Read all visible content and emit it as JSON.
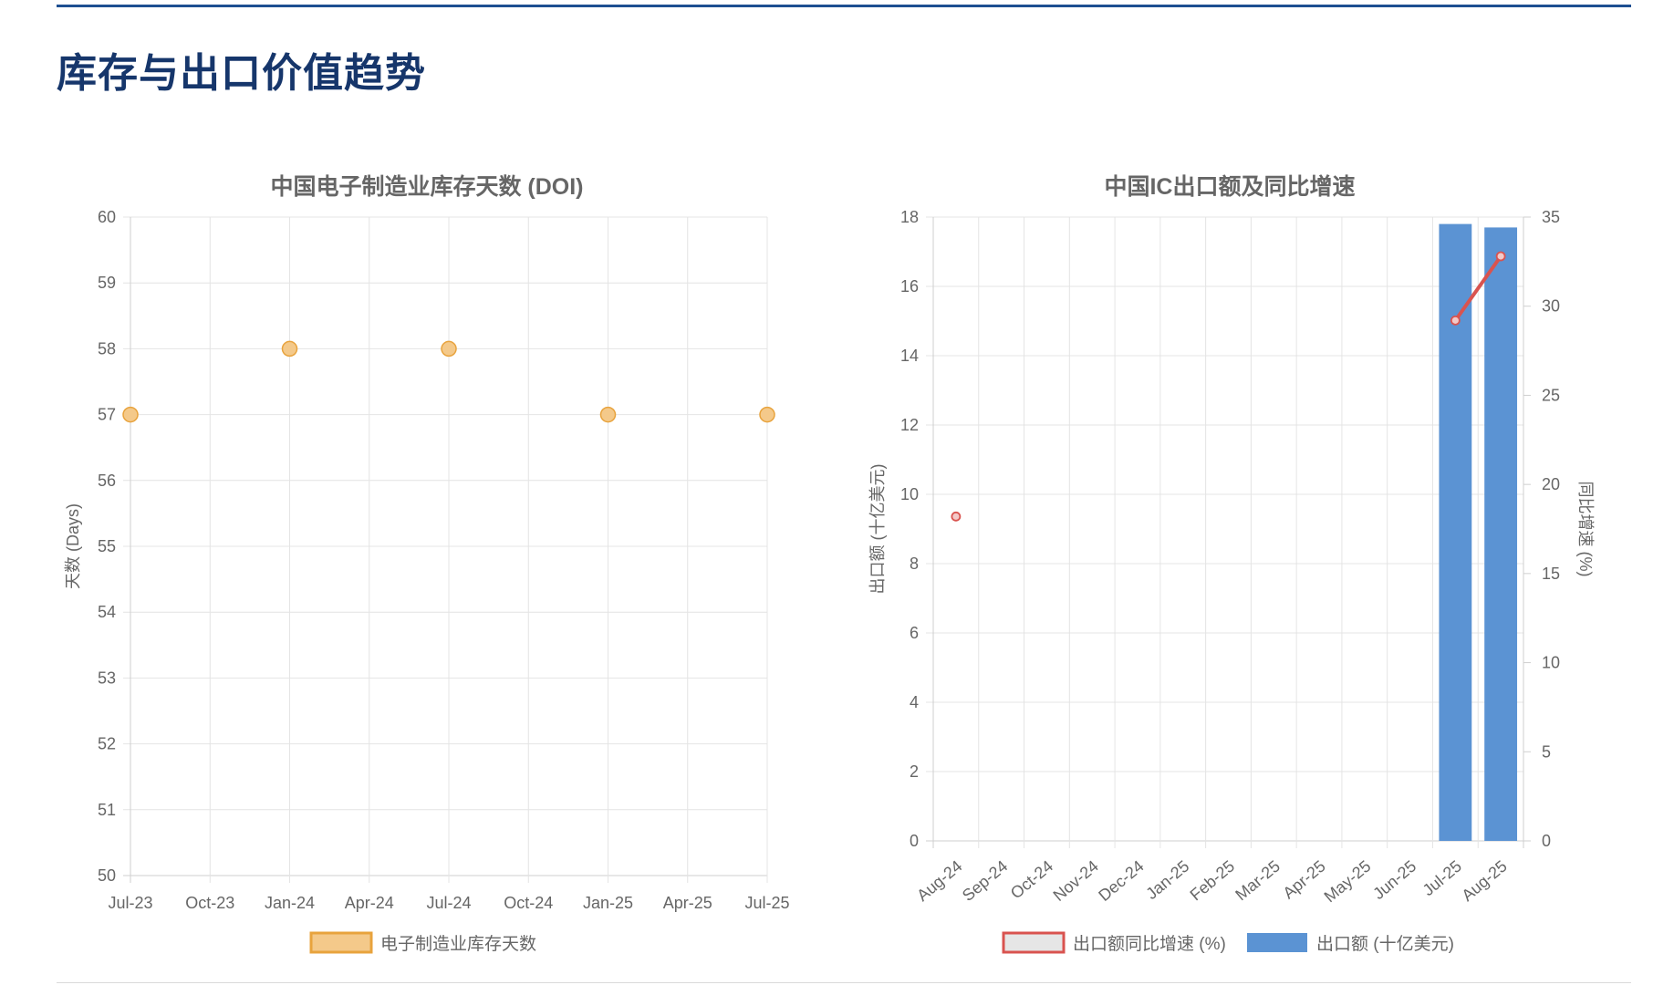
{
  "page": {
    "title": "库存与出口价值趋势"
  },
  "chart_data": [
    {
      "id": "doi",
      "type": "scatter",
      "title": "中国电子制造业库存天数 (DOI)",
      "xlabel": "",
      "ylabel": "天数 (Days)",
      "x_ticks": [
        "Jul-23",
        "Oct-23",
        "Jan-24",
        "Apr-24",
        "Jul-24",
        "Oct-24",
        "Jan-25",
        "Apr-25",
        "Jul-25"
      ],
      "ylim": [
        50,
        60
      ],
      "y_ticks": [
        50,
        51,
        52,
        53,
        54,
        55,
        56,
        57,
        58,
        59,
        60
      ],
      "grid": true,
      "legend_position": "bottom",
      "series": [
        {
          "name": "电子制造业库存天数",
          "color": "#f4c98a",
          "border_color": "#e8a33d",
          "points": [
            {
              "x": "Jul-23",
              "y": 57
            },
            {
              "x": "Jan-24",
              "y": 58
            },
            {
              "x": "Jul-24",
              "y": 58
            },
            {
              "x": "Jan-25",
              "y": 57
            },
            {
              "x": "Jul-25",
              "y": 57
            }
          ]
        }
      ]
    },
    {
      "id": "ic",
      "type": "bar",
      "title": "中国IC出口额及同比增速",
      "categories": [
        "Aug-24",
        "Sep-24",
        "Oct-24",
        "Nov-24",
        "Dec-24",
        "Jan-25",
        "Feb-25",
        "Mar-25",
        "Apr-25",
        "May-25",
        "Jun-25",
        "Jul-25",
        "Aug-25"
      ],
      "ylabel": "出口额 (十亿美元)",
      "y2label": "同比增速 (%)",
      "ylim": [
        0,
        18
      ],
      "y_ticks": [
        0,
        2,
        4,
        6,
        8,
        10,
        12,
        14,
        16,
        18
      ],
      "y2lim": [
        0,
        35
      ],
      "y2_ticks": [
        0,
        5,
        10,
        15,
        20,
        25,
        30,
        35
      ],
      "grid": true,
      "legend_position": "bottom",
      "series": [
        {
          "name": "出口额同比增速 (%)",
          "type": "line",
          "axis": "right",
          "color": "#d9534f",
          "values": [
            18.2,
            null,
            null,
            null,
            null,
            null,
            null,
            null,
            null,
            null,
            null,
            29.2,
            32.8
          ]
        },
        {
          "name": "出口额 (十亿美元)",
          "type": "bar",
          "axis": "left",
          "color": "#5b93d3",
          "values": [
            null,
            null,
            null,
            null,
            null,
            null,
            null,
            null,
            null,
            null,
            null,
            17.8,
            17.7
          ]
        }
      ]
    }
  ]
}
